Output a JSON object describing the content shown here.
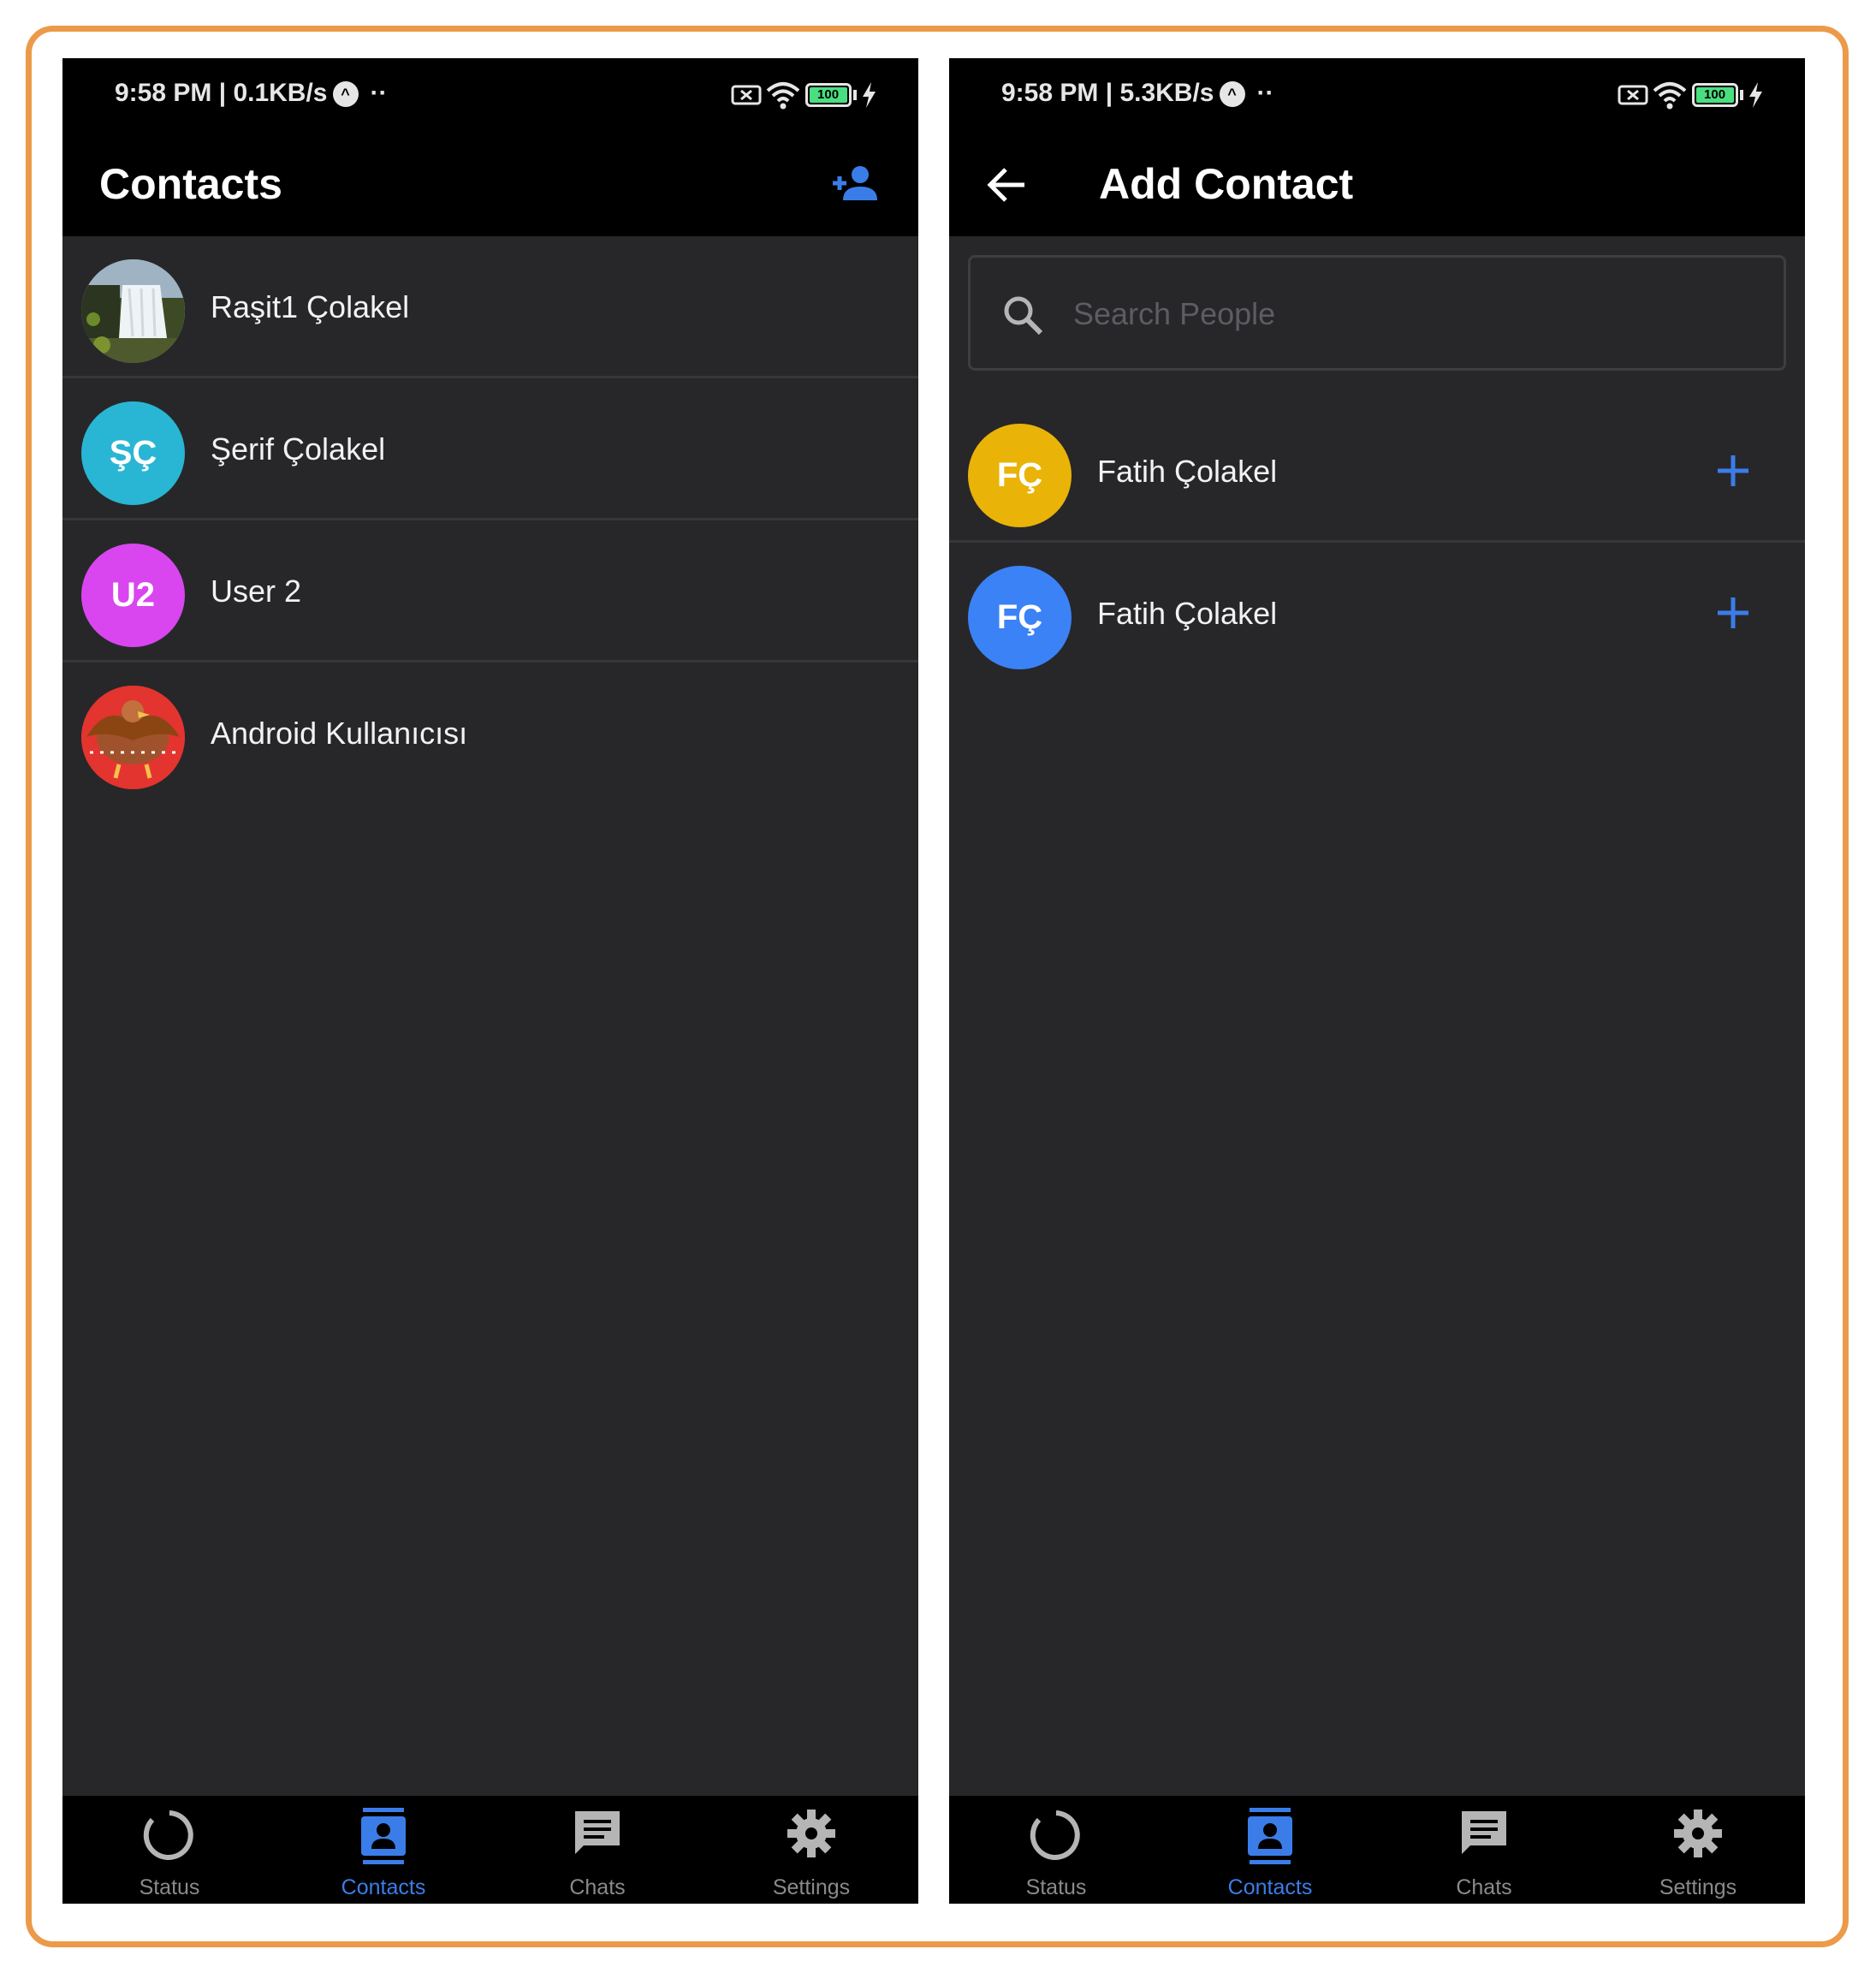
{
  "screens": [
    {
      "status": {
        "time": "9:58 PM | 0.1KB/s",
        "battery": "100"
      },
      "header": {
        "title": "Contacts"
      },
      "contacts": [
        {
          "name": "Raşit1 Çolakel",
          "avatar_type": "photo-waterfall"
        },
        {
          "name": "Şerif Çolakel",
          "initials": "ŞÇ",
          "color": "#29b6d4"
        },
        {
          "name": "User 2",
          "initials": "U2",
          "color": "#d946ef"
        },
        {
          "name": "Android Kullanıcısı",
          "avatar_type": "photo-eagle"
        }
      ]
    },
    {
      "status": {
        "time": "9:58 PM | 5.3KB/s",
        "battery": "100"
      },
      "header": {
        "title": "Add Contact"
      },
      "search": {
        "placeholder": "Search People",
        "value": ""
      },
      "people": [
        {
          "name": "Fatih Çolakel",
          "initials": "FÇ",
          "color": "#eab308"
        },
        {
          "name": "Fatih Çolakel",
          "initials": "FÇ",
          "color": "#3b82f6"
        }
      ]
    }
  ],
  "nav": [
    {
      "label": "Status",
      "icon": "status-ring-icon"
    },
    {
      "label": "Contacts",
      "icon": "contacts-icon",
      "active": true
    },
    {
      "label": "Chats",
      "icon": "chat-icon"
    },
    {
      "label": "Settings",
      "icon": "gear-icon"
    }
  ],
  "colors": {
    "accent": "#3b7de8",
    "frame": "#ec9a49",
    "background": "#27272a"
  }
}
